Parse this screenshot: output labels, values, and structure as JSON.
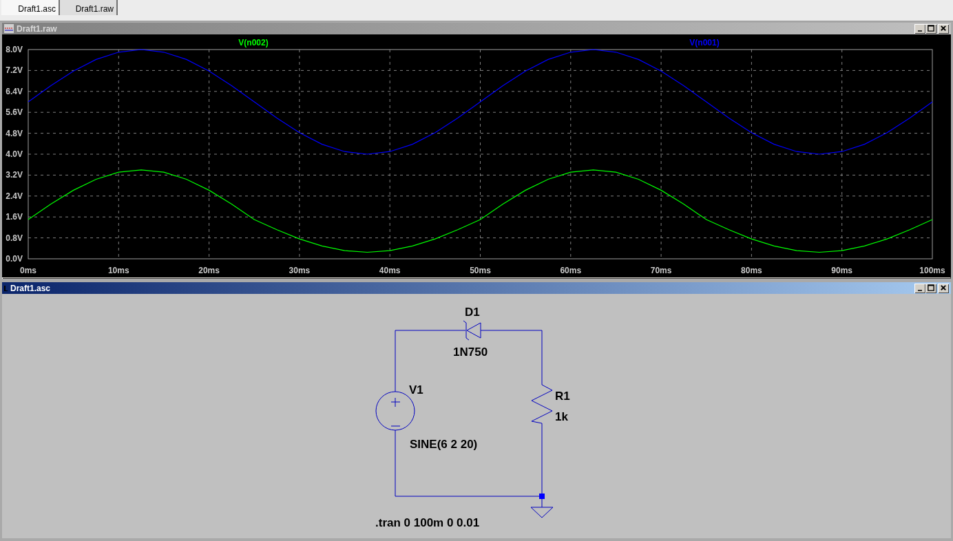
{
  "tabs": [
    {
      "label": "Draft1.asc",
      "selected": true
    },
    {
      "label": "Draft1.raw",
      "selected": false
    }
  ],
  "windows": [
    {
      "kind": "plot",
      "title": "Draft1.raw",
      "active": false,
      "chart_data": {
        "type": "line",
        "x": [
          0,
          2.5,
          5,
          7.5,
          10,
          12.5,
          15,
          17.5,
          20,
          22.5,
          25,
          27.5,
          30,
          32.5,
          35,
          37.5,
          40,
          42.5,
          45,
          47.5,
          50,
          52.5,
          55,
          57.5,
          60,
          62.5,
          65,
          67.5,
          70,
          72.5,
          75,
          77.5,
          80,
          82.5,
          85,
          87.5,
          90,
          92.5,
          95,
          97.5,
          100
        ],
        "series": [
          {
            "name": "V(n002)",
            "color": "#00ff00",
            "values": [
              1.5,
              2.09,
              2.62,
              3.04,
              3.31,
              3.4,
              3.31,
              3.04,
              2.62,
              2.09,
              1.5,
              1.11,
              0.76,
              0.49,
              0.31,
              0.25,
              0.31,
              0.49,
              0.76,
              1.11,
              1.5,
              2.09,
              2.62,
              3.04,
              3.31,
              3.4,
              3.31,
              3.04,
              2.62,
              2.09,
              1.5,
              1.11,
              0.76,
              0.49,
              0.31,
              0.25,
              0.31,
              0.49,
              0.76,
              1.11,
              1.5
            ]
          },
          {
            "name": "V(n001)",
            "color": "#0000ff",
            "values": [
              6,
              6.62,
              7.18,
              7.62,
              7.9,
              8,
              7.9,
              7.62,
              7.18,
              6.62,
              6,
              5.38,
              4.82,
              4.38,
              4.1,
              4,
              4.1,
              4.38,
              4.82,
              5.38,
              6,
              6.62,
              7.18,
              7.62,
              7.9,
              8,
              7.9,
              7.62,
              7.18,
              6.62,
              6,
              5.38,
              4.82,
              4.38,
              4.1,
              4,
              4.1,
              4.38,
              4.82,
              5.38,
              6
            ]
          }
        ],
        "xlim": [
          0,
          100
        ],
        "ylim": [
          0,
          8
        ],
        "grid": true,
        "xticks": [
          {
            "value": 0,
            "label": "0ms"
          },
          {
            "value": 10,
            "label": "10ms"
          },
          {
            "value": 20,
            "label": "20ms"
          },
          {
            "value": 30,
            "label": "30ms"
          },
          {
            "value": 40,
            "label": "40ms"
          },
          {
            "value": 50,
            "label": "50ms"
          },
          {
            "value": 60,
            "label": "60ms"
          },
          {
            "value": 70,
            "label": "70ms"
          },
          {
            "value": 80,
            "label": "80ms"
          },
          {
            "value": 90,
            "label": "90ms"
          },
          {
            "value": 100,
            "label": "100ms"
          }
        ],
        "yticks": [
          {
            "value": 0,
            "label": "0.0V"
          },
          {
            "value": 0.8,
            "label": "0.8V"
          },
          {
            "value": 1.6,
            "label": "1.6V"
          },
          {
            "value": 2.4,
            "label": "2.4V"
          },
          {
            "value": 3.2,
            "label": "3.2V"
          },
          {
            "value": 4,
            "label": "4.0V"
          },
          {
            "value": 4.8,
            "label": "4.8V"
          },
          {
            "value": 5.6,
            "label": "5.6V"
          },
          {
            "value": 6.4,
            "label": "6.4V"
          },
          {
            "value": 7.2,
            "label": "7.2V"
          },
          {
            "value": 8,
            "label": "8.0V"
          }
        ]
      }
    },
    {
      "kind": "schematic",
      "title": "Draft1.asc",
      "active": true,
      "components": [
        {
          "kind": "diode",
          "name": "D1",
          "value": "1N750"
        },
        {
          "kind": "voltage_source",
          "name": "V1",
          "value": "SINE(6 2 20)"
        },
        {
          "kind": "resistor",
          "name": "R1",
          "value": "1k"
        }
      ],
      "directive": ".tran 0 100m 0 0.01"
    }
  ]
}
